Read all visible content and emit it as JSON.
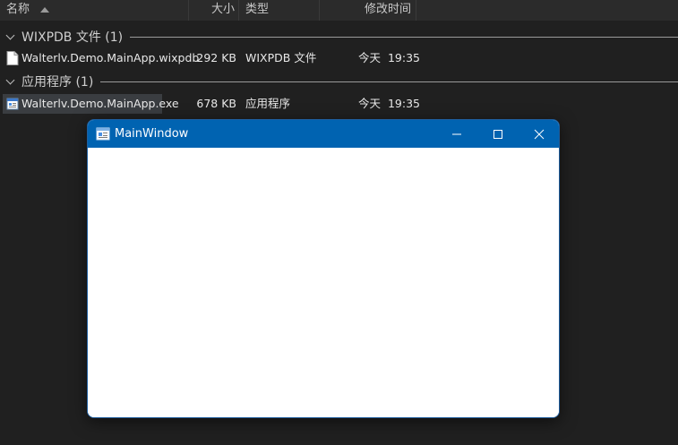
{
  "columns": {
    "name": "名称",
    "size": "大小",
    "type": "类型",
    "date": "修改时间"
  },
  "groups": [
    {
      "title": "WIXPDB 文件 (1)",
      "files": [
        {
          "name": "Walterlv.Demo.MainApp.wixpdb",
          "size": "292 KB",
          "type": "WIXPDB 文件",
          "date": "今天",
          "time": "19:35",
          "icon": "document-icon"
        }
      ]
    },
    {
      "title": "应用程序 (1)",
      "files": [
        {
          "name": "Walterlv.Demo.MainApp.exe",
          "size": "678 KB",
          "type": "应用程序",
          "date": "今天",
          "time": "19:35",
          "icon": "app-exe-icon"
        }
      ]
    }
  ],
  "window": {
    "title": "MainWindow",
    "accent": "#0063b1",
    "icon": "app-exe-icon",
    "controls": [
      "minimize-icon",
      "maximize-icon",
      "close-icon"
    ]
  }
}
